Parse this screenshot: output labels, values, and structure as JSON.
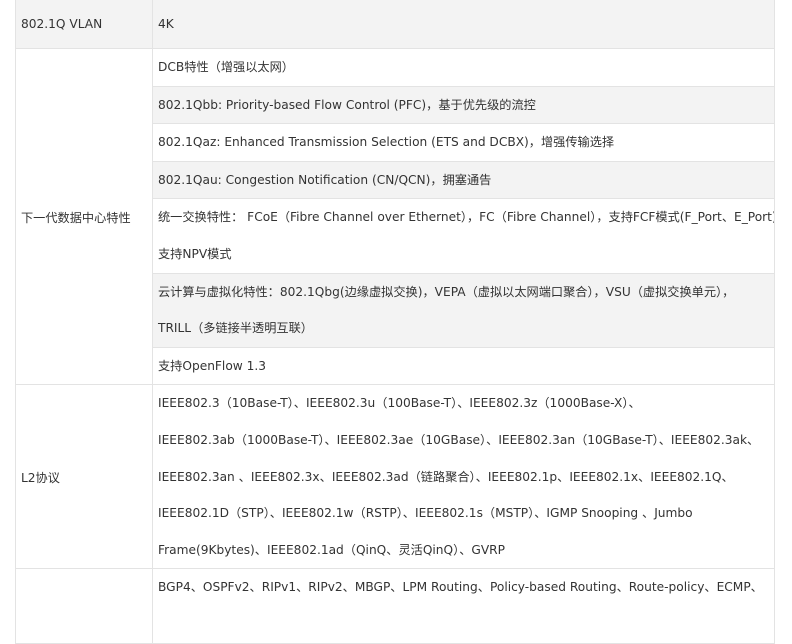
{
  "rows": [
    {
      "key": "802.1Q VLAN",
      "items": [
        {
          "lines": [
            "4K"
          ]
        }
      ]
    },
    {
      "key": "下一代数据中心特性",
      "items": [
        {
          "lines": [
            "DCB特性（增强以太网）"
          ]
        },
        {
          "lines": [
            "802.1Qbb: Priority-based Flow Control (PFC)，基于优先级的流控"
          ]
        },
        {
          "lines": [
            "802.1Qaz: Enhanced Transmission Selection (ETS and DCBX)，增强传输选择"
          ]
        },
        {
          "lines": [
            "802.1Qau: Congestion Notification (CN/QCN)，拥塞通告"
          ]
        },
        {
          "lines": [
            "统一交换特性： FCoE（Fibre Channel over Ethernet），FC（Fibre Channel），支持FCF模式(F_Port、E_Port)，",
            "支持NPV模式"
          ]
        },
        {
          "lines": [
            "云计算与虚拟化特性：802.1Qbg(边缘虚拟交换)，VEPA（虚拟以太网端口聚合），VSU（虚拟交换单元），",
            "TRILL（多链接半透明互联）"
          ]
        },
        {
          "lines": [
            "支持OpenFlow 1.3"
          ]
        }
      ]
    },
    {
      "key": "L2协议",
      "items": [
        {
          "lines": [
            "IEEE802.3（10Base-T）、IEEE802.3u（100Base-T）、IEEE802.3z（1000Base-X）、",
            "IEEE802.3ab（1000Base-T）、IEEE802.3ae（10GBase）、IEEE802.3an（10GBase-T）、IEEE802.3ak、",
            "IEEE802.3an 、IEEE802.3x、IEEE802.3ad（链路聚合）、IEEE802.1p、IEEE802.1x、IEEE802.1Q、",
            "IEEE802.1D（STP）、IEEE802.1w（RSTP）、IEEE802.1s（MSTP）、IGMP Snooping 、Jumbo",
            "Frame(9Kbytes)、IEEE802.1ad（QinQ、灵活QinQ）、GVRP"
          ]
        }
      ]
    },
    {
      "key": "",
      "items": [
        {
          "lines": [
            "BGP4、OSPFv2、RIPv1、RIPv2、MBGP、LPM Routing、Policy-based Routing、Route-policy、ECMP、"
          ]
        }
      ]
    }
  ]
}
